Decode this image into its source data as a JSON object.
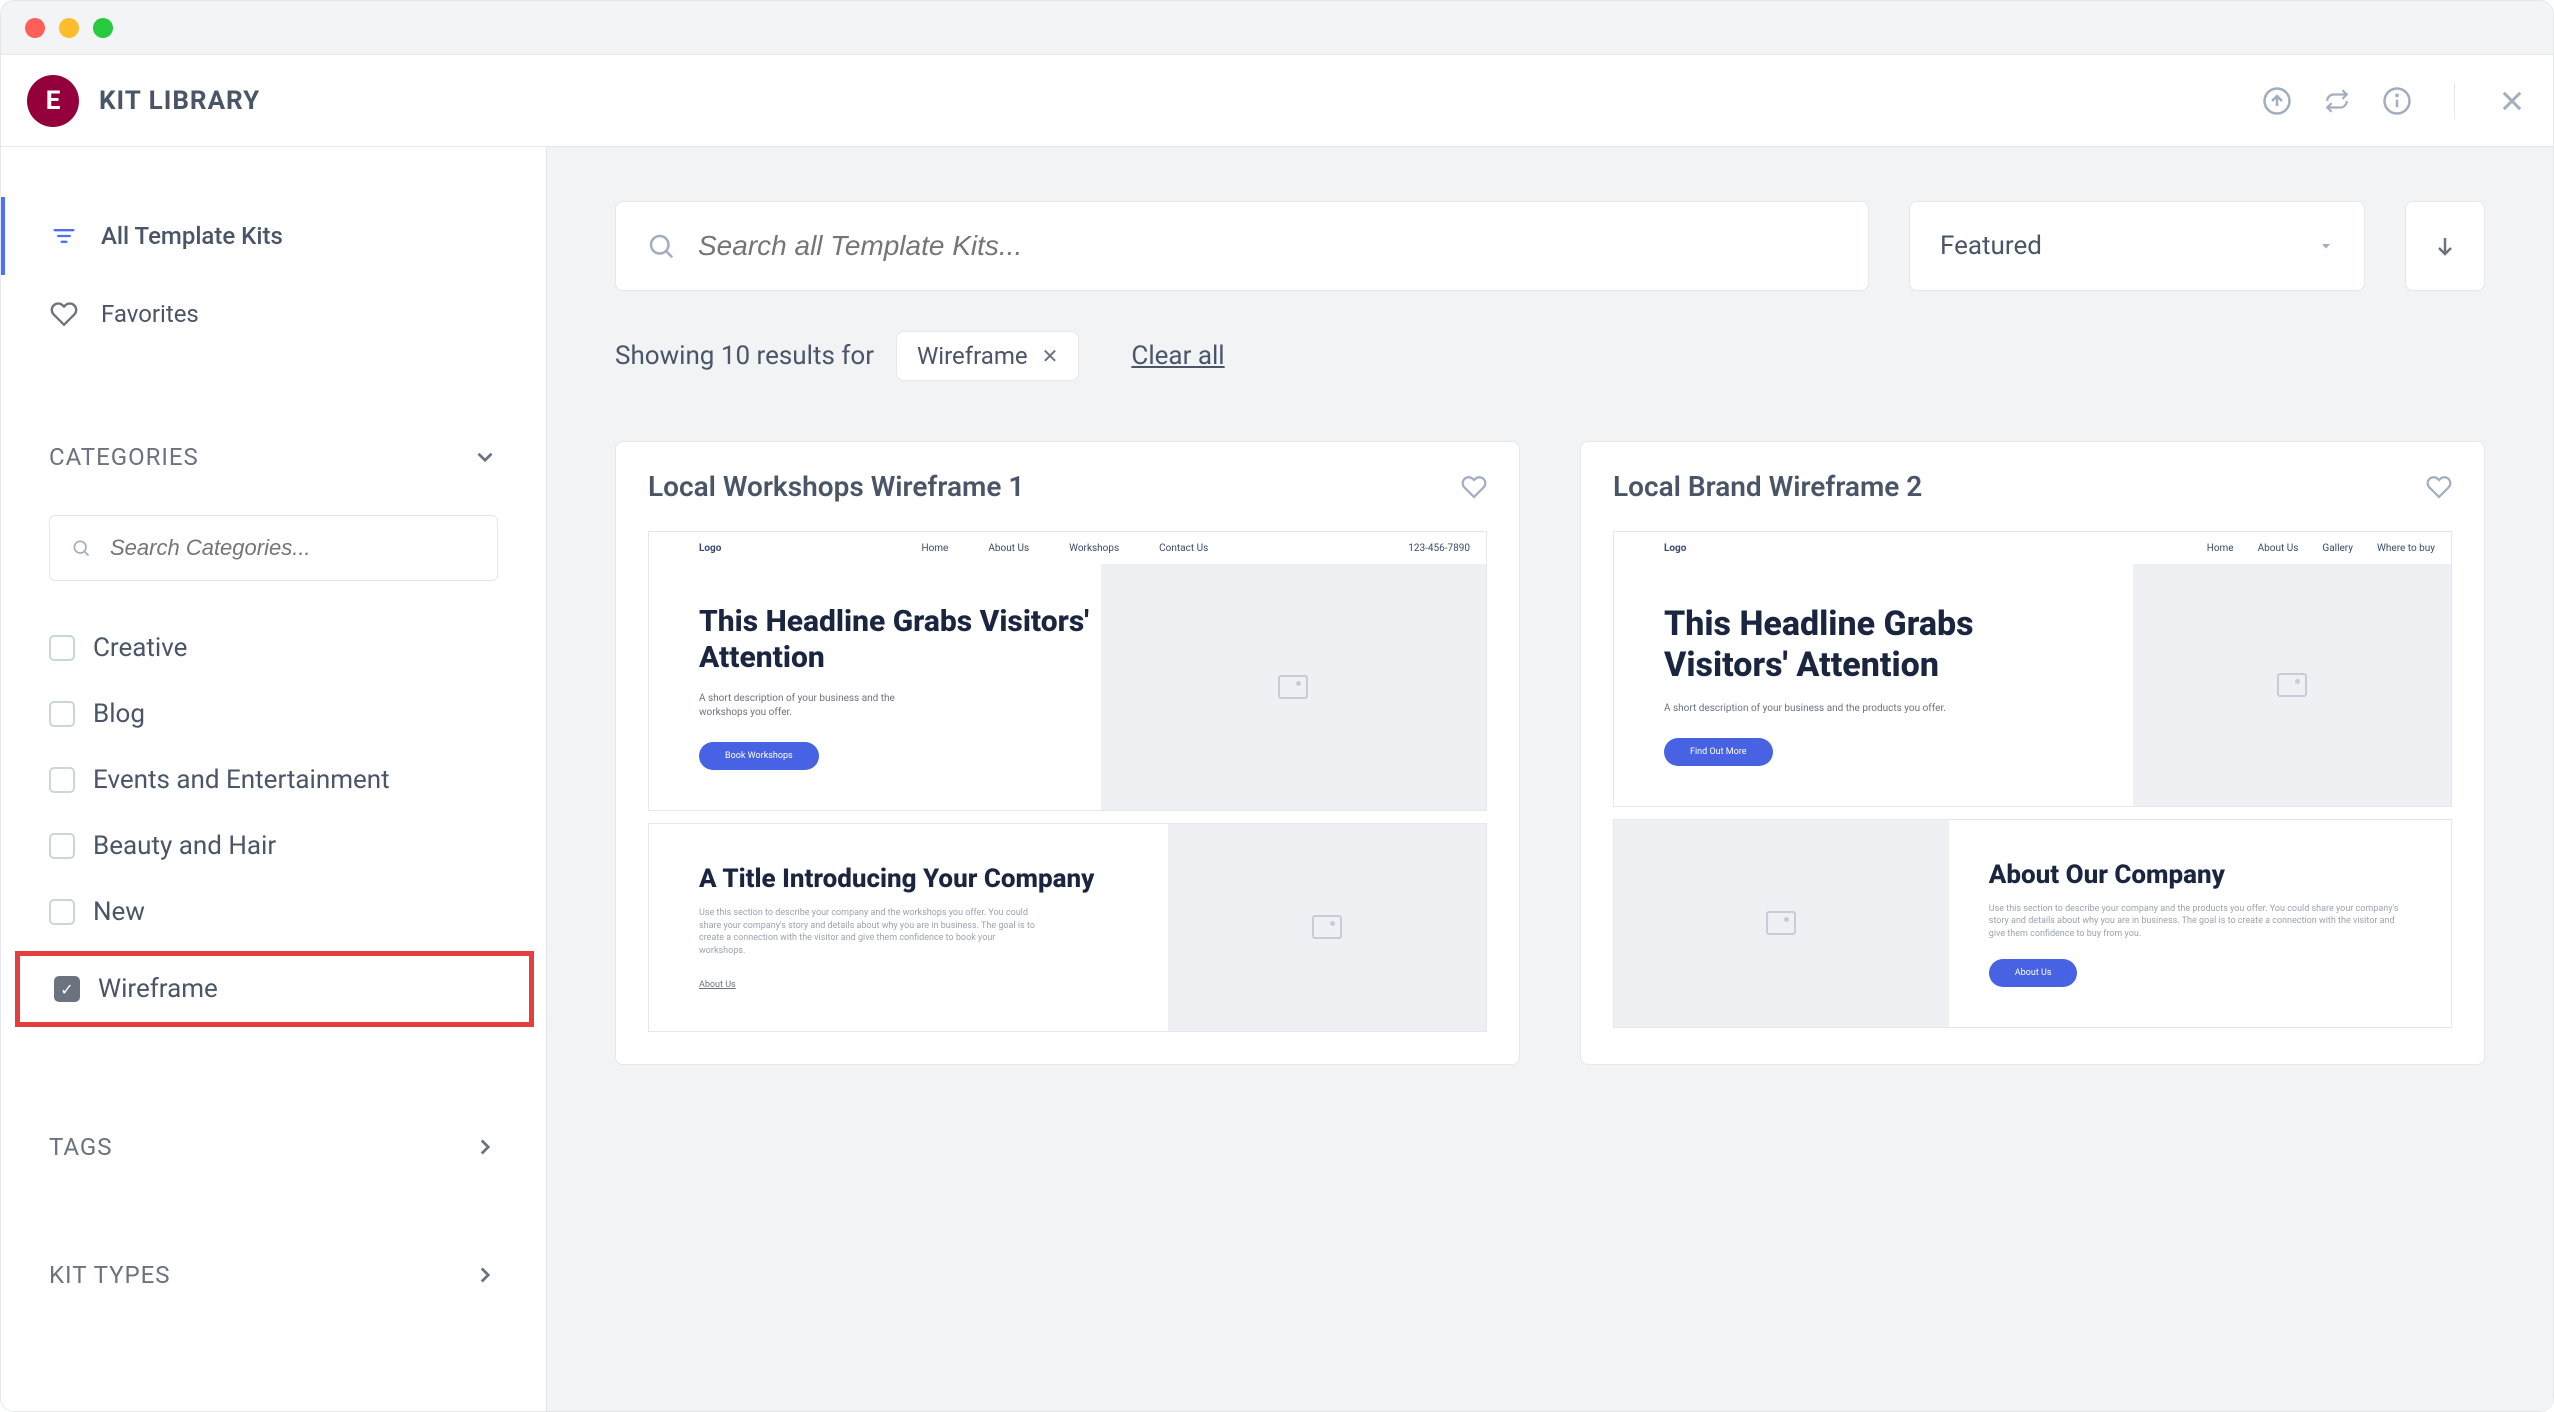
{
  "brand": {
    "title": "KIT LIBRARY",
    "logo_letter": "E"
  },
  "sidebar": {
    "nav": [
      {
        "label": "All Template Kits",
        "active": true
      },
      {
        "label": "Favorites",
        "active": false
      }
    ],
    "categories_label": "CATEGORIES",
    "category_search_placeholder": "Search Categories...",
    "categories": [
      {
        "label": "Creative",
        "checked": false
      },
      {
        "label": "Blog",
        "checked": false
      },
      {
        "label": "Events and Entertainment",
        "checked": false
      },
      {
        "label": "Beauty and Hair",
        "checked": false
      },
      {
        "label": "New",
        "checked": false
      },
      {
        "label": "Wireframe",
        "checked": true
      }
    ],
    "tags_label": "TAGS",
    "kit_types_label": "KIT TYPES"
  },
  "search": {
    "placeholder": "Search all Template Kits..."
  },
  "sort": {
    "selected": "Featured"
  },
  "results": {
    "prefix": "Showing 10 results for",
    "chip": "Wireframe",
    "clear_all": "Clear all"
  },
  "cards": [
    {
      "title": "Local Workshops Wireframe 1",
      "preview": {
        "logo": "Logo",
        "nav_links": [
          "Home",
          "About Us",
          "Workshops",
          "Contact Us"
        ],
        "phone": "123-456-7890",
        "hero_headline": "This Headline Grabs Visitors' Attention",
        "hero_sub": "A short description of your business and the workshops you offer.",
        "hero_btn": "Book Workshops",
        "about_title": "A Title Introducing Your Company",
        "about_text": "Use this section to describe your company and the workshops you offer. You could share your company's story and details about why you are in business. The goal is to create a connection with the visitor and give them confidence to book your workshops.",
        "about_link": "About Us"
      }
    },
    {
      "title": "Local Brand Wireframe 2",
      "preview": {
        "logo": "Logo",
        "nav_links": [
          "Home",
          "About Us",
          "Gallery",
          "Where to buy"
        ],
        "hero_headline": "This Headline Grabs Visitors' Attention",
        "hero_sub": "A short description of your business and the products you offer.",
        "hero_btn": "Find Out More",
        "about_title": "About Our Company",
        "about_text": "Use this section to describe your company and the products you offer. You could share your company's story and details about why you are in business. The goal is to create a connection with the visitor and give them confidence to buy from you.",
        "about_btn": "About Us"
      }
    }
  ]
}
